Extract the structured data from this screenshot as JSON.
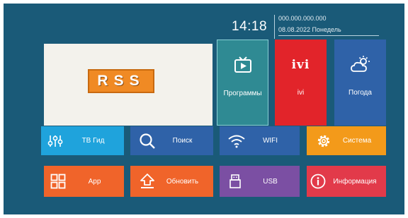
{
  "status": {
    "time": "14:18",
    "ip": "000.000.000.000",
    "date": "08.08.2022  Понедель"
  },
  "banner": {
    "logo_text": "RSS"
  },
  "big_tiles": [
    {
      "label": "Программы",
      "icon": "tv-play-icon",
      "color": "#2f8a93"
    },
    {
      "label": "ivi",
      "icon": "ivi-logo",
      "logo_text": "ivi",
      "color": "#e2242a"
    },
    {
      "label": "Погода",
      "icon": "weather-icon",
      "color": "#2f62a8"
    }
  ],
  "small_tiles": [
    {
      "label": "ТВ Гид",
      "icon": "tv-guide-sliders-icon",
      "color": "#1fa3dc"
    },
    {
      "label": "Поиск",
      "icon": "search-icon",
      "color": "#2f62a8"
    },
    {
      "label": "WIFI",
      "icon": "wifi-icon",
      "color": "#2f62a8"
    },
    {
      "label": "Система",
      "icon": "gear-icon",
      "color": "#f39a1a"
    },
    {
      "label": "App",
      "icon": "apps-grid-icon",
      "color": "#f0642a"
    },
    {
      "label": "Обновить",
      "icon": "upload-icon",
      "color": "#f0642a"
    },
    {
      "label": "USB",
      "icon": "usb-icon",
      "color": "#7b4fa3"
    },
    {
      "label": "Информация",
      "icon": "info-icon",
      "color": "#e23a4a"
    }
  ]
}
